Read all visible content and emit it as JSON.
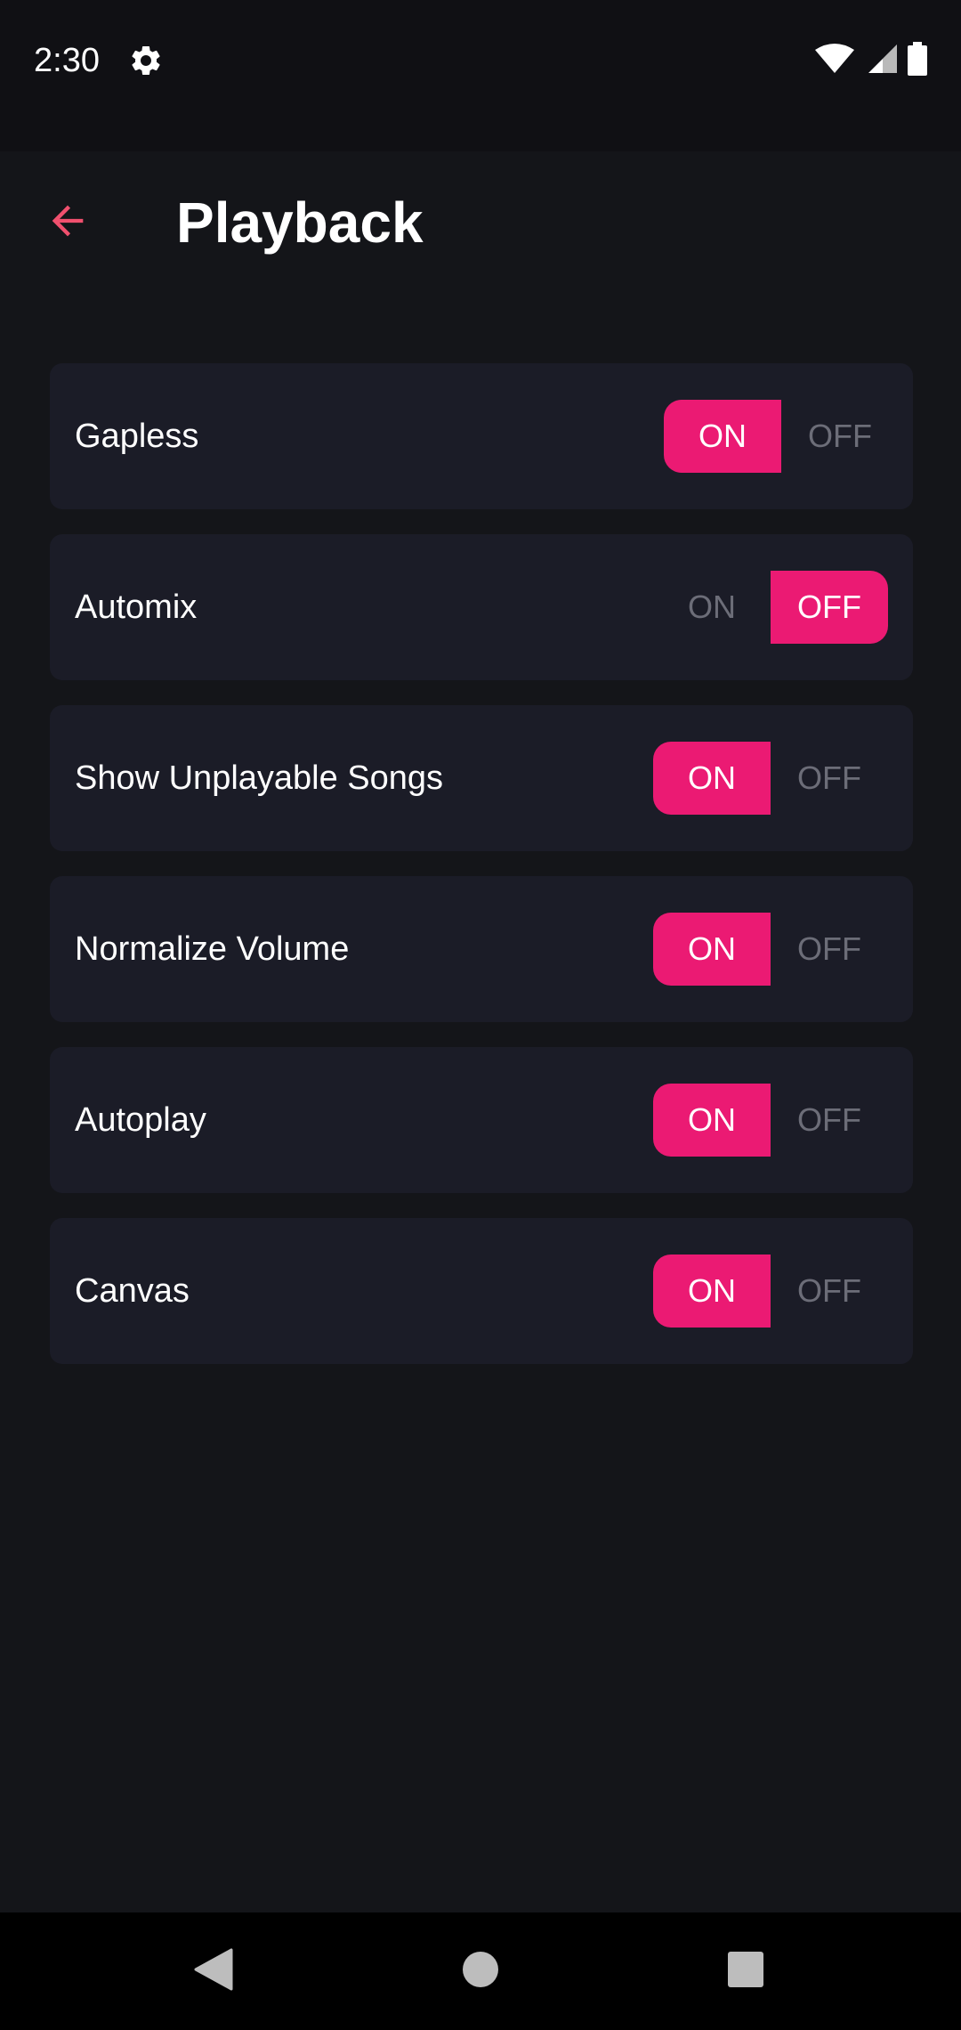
{
  "status_bar": {
    "time": "2:30",
    "icons": [
      "gear-icon",
      "wifi-icon",
      "signal-icon",
      "battery-icon"
    ]
  },
  "app_bar": {
    "back_icon": "arrow-left-icon",
    "title": "Playback"
  },
  "colors": {
    "accent": "#eb1a73",
    "back_arrow": "#f0506e",
    "background": "#141519",
    "card": "#1b1c27",
    "inactive_text": "#6c6d78"
  },
  "settings": [
    {
      "label": "Gapless",
      "on_label": "ON",
      "off_label": "OFF",
      "value": "ON"
    },
    {
      "label": "Automix",
      "on_label": "ON",
      "off_label": "OFF",
      "value": "OFF"
    },
    {
      "label": "Show Unplayable Songs",
      "on_label": "ON",
      "off_label": "OFF",
      "value": "ON"
    },
    {
      "label": "Normalize Volume",
      "on_label": "ON",
      "off_label": "OFF",
      "value": "ON"
    },
    {
      "label": "Autoplay",
      "on_label": "ON",
      "off_label": "OFF",
      "value": "ON"
    },
    {
      "label": "Canvas",
      "on_label": "ON",
      "off_label": "OFF",
      "value": "ON"
    }
  ],
  "nav_bar": {
    "icons": [
      "back-triangle-icon",
      "home-circle-icon",
      "recents-square-icon"
    ]
  }
}
